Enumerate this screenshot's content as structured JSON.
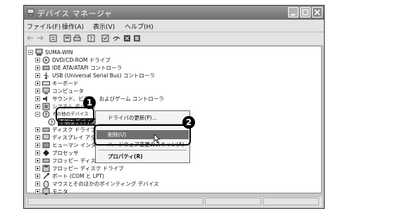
{
  "window": {
    "title": "デバイス マネージャ",
    "icon": "device-manager-icon"
  },
  "menu": [
    "ファイル(F)",
    "操作(A)",
    "表示(V)",
    "ヘルプ(H)"
  ],
  "toolbar": {
    "buttons": [
      "back-arrow-icon",
      "forward-arrow-icon",
      "view-icon",
      "properties-icon",
      "print-icon",
      "help-icon",
      "scan-icon",
      "uninstall-icon",
      "disable-icon",
      "update-driver-icon"
    ]
  },
  "tree": {
    "root": "SUMA-WIN",
    "items": [
      {
        "label": "DVD/CD-ROM ドライブ",
        "icon": "cdrom-icon"
      },
      {
        "label": "IDE ATA/ATAPI コントローラ",
        "icon": "ide-controller-icon"
      },
      {
        "label": "USB (Universal Serial Bus) コントローラ",
        "icon": "usb-icon"
      },
      {
        "label": "キーボード",
        "icon": "keyboard-icon"
      },
      {
        "label": "コンピュータ",
        "icon": "computer-icon"
      },
      {
        "label": "サウンド、ビデオ、およびゲーム コントローラ",
        "icon": "sound-icon"
      },
      {
        "label": "システム デバイス",
        "icon": "system-device-icon"
      },
      {
        "label": "その他のデバイス",
        "icon": "other-devices-icon"
      },
      {
        "label": "不明なデバイス",
        "icon": "unknown-device-icon"
      },
      {
        "label": "ディスク ドライブ",
        "icon": "disk-icon"
      },
      {
        "label": "ディスプレイ アダプタ",
        "icon": "display-adapter-icon"
      },
      {
        "label": "ヒューマン インタフェース デバイス",
        "icon": "hid-icon"
      },
      {
        "label": "プロセッサ",
        "icon": "processor-icon"
      },
      {
        "label": "フロッピー ディスク コントローラ",
        "icon": "floppy-controller-icon"
      },
      {
        "label": "フロッピー ディスク ドライブ",
        "icon": "floppy-drive-icon"
      },
      {
        "label": "ポート (COM と LPT)",
        "icon": "port-icon"
      },
      {
        "label": "マウスとそのほかのポインティング デバイス",
        "icon": "mouse-icon"
      },
      {
        "label": "モニタ",
        "icon": "monitor-icon"
      }
    ]
  },
  "context_menu": {
    "items": [
      "ドライバの更新(P)...",
      "削除(U)",
      "ハードウェア変更のスキャン(A)",
      "プロパティ(R)"
    ]
  },
  "callouts": [
    "1",
    "2"
  ],
  "colors": {
    "title_bar": "#6e6e6e",
    "highlight": "#6f6f6f",
    "callout": "#000000"
  }
}
